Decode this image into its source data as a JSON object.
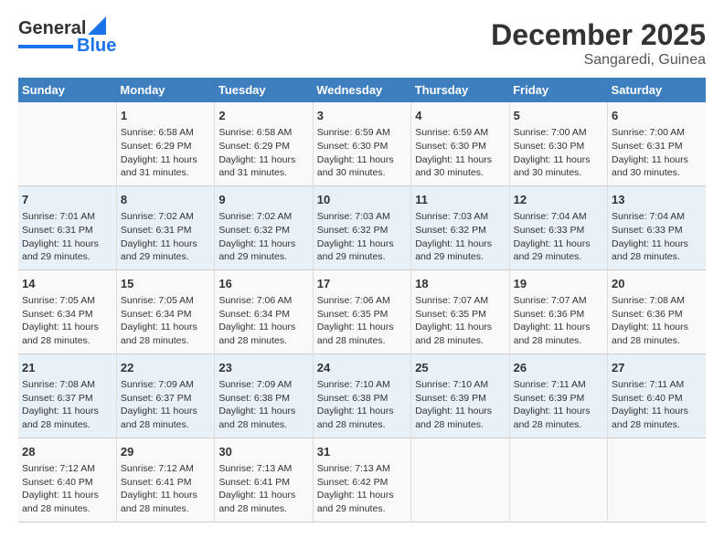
{
  "header": {
    "logo": {
      "general": "General",
      "blue": "Blue"
    },
    "title": "December 2025",
    "subtitle": "Sangaredi, Guinea"
  },
  "calendar": {
    "days_of_week": [
      "Sunday",
      "Monday",
      "Tuesday",
      "Wednesday",
      "Thursday",
      "Friday",
      "Saturday"
    ],
    "weeks": [
      [
        {
          "day": "",
          "sunrise": "",
          "sunset": "",
          "daylight": ""
        },
        {
          "day": "1",
          "sunrise": "Sunrise: 6:58 AM",
          "sunset": "Sunset: 6:29 PM",
          "daylight": "Daylight: 11 hours and 31 minutes."
        },
        {
          "day": "2",
          "sunrise": "Sunrise: 6:58 AM",
          "sunset": "Sunset: 6:29 PM",
          "daylight": "Daylight: 11 hours and 31 minutes."
        },
        {
          "day": "3",
          "sunrise": "Sunrise: 6:59 AM",
          "sunset": "Sunset: 6:30 PM",
          "daylight": "Daylight: 11 hours and 30 minutes."
        },
        {
          "day": "4",
          "sunrise": "Sunrise: 6:59 AM",
          "sunset": "Sunset: 6:30 PM",
          "daylight": "Daylight: 11 hours and 30 minutes."
        },
        {
          "day": "5",
          "sunrise": "Sunrise: 7:00 AM",
          "sunset": "Sunset: 6:30 PM",
          "daylight": "Daylight: 11 hours and 30 minutes."
        },
        {
          "day": "6",
          "sunrise": "Sunrise: 7:00 AM",
          "sunset": "Sunset: 6:31 PM",
          "daylight": "Daylight: 11 hours and 30 minutes."
        }
      ],
      [
        {
          "day": "7",
          "sunrise": "Sunrise: 7:01 AM",
          "sunset": "Sunset: 6:31 PM",
          "daylight": "Daylight: 11 hours and 29 minutes."
        },
        {
          "day": "8",
          "sunrise": "Sunrise: 7:02 AM",
          "sunset": "Sunset: 6:31 PM",
          "daylight": "Daylight: 11 hours and 29 minutes."
        },
        {
          "day": "9",
          "sunrise": "Sunrise: 7:02 AM",
          "sunset": "Sunset: 6:32 PM",
          "daylight": "Daylight: 11 hours and 29 minutes."
        },
        {
          "day": "10",
          "sunrise": "Sunrise: 7:03 AM",
          "sunset": "Sunset: 6:32 PM",
          "daylight": "Daylight: 11 hours and 29 minutes."
        },
        {
          "day": "11",
          "sunrise": "Sunrise: 7:03 AM",
          "sunset": "Sunset: 6:32 PM",
          "daylight": "Daylight: 11 hours and 29 minutes."
        },
        {
          "day": "12",
          "sunrise": "Sunrise: 7:04 AM",
          "sunset": "Sunset: 6:33 PM",
          "daylight": "Daylight: 11 hours and 29 minutes."
        },
        {
          "day": "13",
          "sunrise": "Sunrise: 7:04 AM",
          "sunset": "Sunset: 6:33 PM",
          "daylight": "Daylight: 11 hours and 28 minutes."
        }
      ],
      [
        {
          "day": "14",
          "sunrise": "Sunrise: 7:05 AM",
          "sunset": "Sunset: 6:34 PM",
          "daylight": "Daylight: 11 hours and 28 minutes."
        },
        {
          "day": "15",
          "sunrise": "Sunrise: 7:05 AM",
          "sunset": "Sunset: 6:34 PM",
          "daylight": "Daylight: 11 hours and 28 minutes."
        },
        {
          "day": "16",
          "sunrise": "Sunrise: 7:06 AM",
          "sunset": "Sunset: 6:34 PM",
          "daylight": "Daylight: 11 hours and 28 minutes."
        },
        {
          "day": "17",
          "sunrise": "Sunrise: 7:06 AM",
          "sunset": "Sunset: 6:35 PM",
          "daylight": "Daylight: 11 hours and 28 minutes."
        },
        {
          "day": "18",
          "sunrise": "Sunrise: 7:07 AM",
          "sunset": "Sunset: 6:35 PM",
          "daylight": "Daylight: 11 hours and 28 minutes."
        },
        {
          "day": "19",
          "sunrise": "Sunrise: 7:07 AM",
          "sunset": "Sunset: 6:36 PM",
          "daylight": "Daylight: 11 hours and 28 minutes."
        },
        {
          "day": "20",
          "sunrise": "Sunrise: 7:08 AM",
          "sunset": "Sunset: 6:36 PM",
          "daylight": "Daylight: 11 hours and 28 minutes."
        }
      ],
      [
        {
          "day": "21",
          "sunrise": "Sunrise: 7:08 AM",
          "sunset": "Sunset: 6:37 PM",
          "daylight": "Daylight: 11 hours and 28 minutes."
        },
        {
          "day": "22",
          "sunrise": "Sunrise: 7:09 AM",
          "sunset": "Sunset: 6:37 PM",
          "daylight": "Daylight: 11 hours and 28 minutes."
        },
        {
          "day": "23",
          "sunrise": "Sunrise: 7:09 AM",
          "sunset": "Sunset: 6:38 PM",
          "daylight": "Daylight: 11 hours and 28 minutes."
        },
        {
          "day": "24",
          "sunrise": "Sunrise: 7:10 AM",
          "sunset": "Sunset: 6:38 PM",
          "daylight": "Daylight: 11 hours and 28 minutes."
        },
        {
          "day": "25",
          "sunrise": "Sunrise: 7:10 AM",
          "sunset": "Sunset: 6:39 PM",
          "daylight": "Daylight: 11 hours and 28 minutes."
        },
        {
          "day": "26",
          "sunrise": "Sunrise: 7:11 AM",
          "sunset": "Sunset: 6:39 PM",
          "daylight": "Daylight: 11 hours and 28 minutes."
        },
        {
          "day": "27",
          "sunrise": "Sunrise: 7:11 AM",
          "sunset": "Sunset: 6:40 PM",
          "daylight": "Daylight: 11 hours and 28 minutes."
        }
      ],
      [
        {
          "day": "28",
          "sunrise": "Sunrise: 7:12 AM",
          "sunset": "Sunset: 6:40 PM",
          "daylight": "Daylight: 11 hours and 28 minutes."
        },
        {
          "day": "29",
          "sunrise": "Sunrise: 7:12 AM",
          "sunset": "Sunset: 6:41 PM",
          "daylight": "Daylight: 11 hours and 28 minutes."
        },
        {
          "day": "30",
          "sunrise": "Sunrise: 7:13 AM",
          "sunset": "Sunset: 6:41 PM",
          "daylight": "Daylight: 11 hours and 28 minutes."
        },
        {
          "day": "31",
          "sunrise": "Sunrise: 7:13 AM",
          "sunset": "Sunset: 6:42 PM",
          "daylight": "Daylight: 11 hours and 29 minutes."
        },
        {
          "day": "",
          "sunrise": "",
          "sunset": "",
          "daylight": ""
        },
        {
          "day": "",
          "sunrise": "",
          "sunset": "",
          "daylight": ""
        },
        {
          "day": "",
          "sunrise": "",
          "sunset": "",
          "daylight": ""
        }
      ]
    ]
  }
}
